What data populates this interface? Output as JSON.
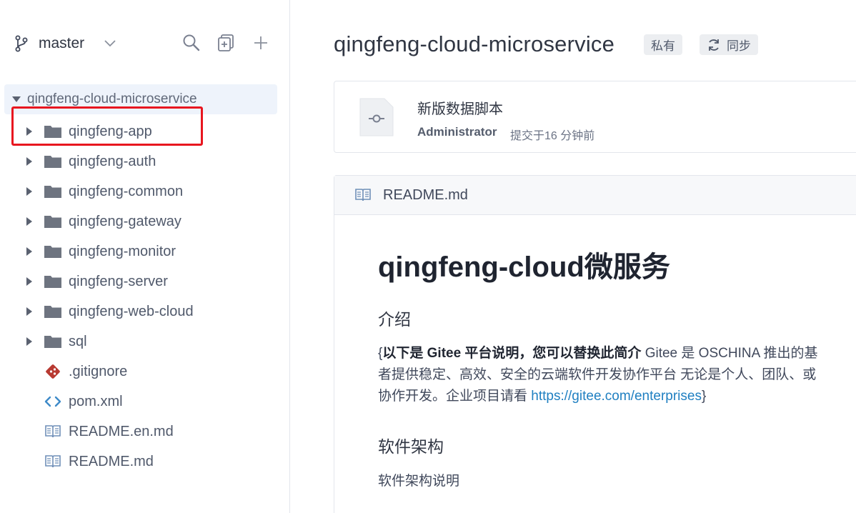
{
  "branch": {
    "name": "master"
  },
  "tree": {
    "root": "qingfeng-cloud-microservice",
    "items": [
      {
        "label": "qingfeng-app",
        "type": "folder"
      },
      {
        "label": "qingfeng-auth",
        "type": "folder"
      },
      {
        "label": "qingfeng-common",
        "type": "folder"
      },
      {
        "label": "qingfeng-gateway",
        "type": "folder"
      },
      {
        "label": "qingfeng-monitor",
        "type": "folder"
      },
      {
        "label": "qingfeng-server",
        "type": "folder"
      },
      {
        "label": "qingfeng-web-cloud",
        "type": "folder"
      },
      {
        "label": "sql",
        "type": "folder"
      },
      {
        "label": ".gitignore",
        "type": "git"
      },
      {
        "label": "pom.xml",
        "type": "code"
      },
      {
        "label": "README.en.md",
        "type": "book"
      },
      {
        "label": "README.md",
        "type": "book"
      }
    ]
  },
  "repo": {
    "title": "qingfeng-cloud-microservice",
    "private_badge": "私有",
    "sync_label": "同步"
  },
  "commit": {
    "message": "新版数据脚本",
    "author": "Administrator",
    "time": "提交于16 分钟前"
  },
  "readme": {
    "filename": "README.md",
    "h1": "qingfeng-cloud微服务",
    "section_intro": "介绍",
    "intro_open": "{",
    "intro_bold": "以下是 Gitee 平台说明，您可以替换此简介",
    "intro_line1_rest": " Gitee 是 OSCHINA 推出的基",
    "intro_line2": "者提供稳定、高效、安全的云端软件开发协作平台 无论是个人、团队、或",
    "intro_line3_pre": "协作开发。企业项目请看 ",
    "intro_link": "https://gitee.com/enterprises",
    "intro_close": "}",
    "section_arch": "软件架构",
    "arch_desc": "软件架构说明"
  },
  "colors": {
    "accent": "#1f7fc1",
    "highlight": "#e8161f",
    "folder": "#6e7480",
    "git": "#c0392b"
  }
}
